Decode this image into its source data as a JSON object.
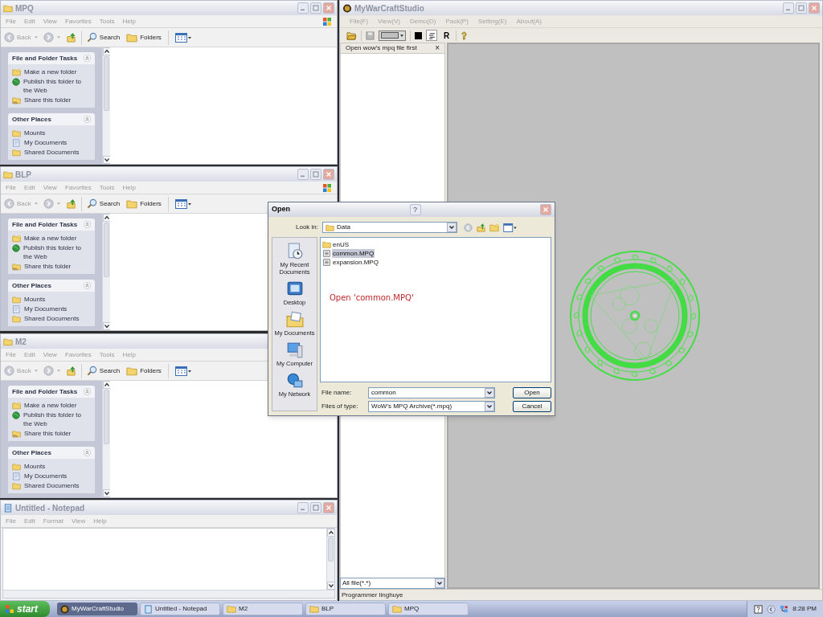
{
  "explorer_windows": [
    {
      "title": "MPQ",
      "menu": [
        "File",
        "Edit",
        "View",
        "Favorites",
        "Tools",
        "Help"
      ],
      "toolbar": {
        "back": "Back",
        "search": "Search",
        "folders": "Folders"
      },
      "task_sections": [
        {
          "title": "File and Folder Tasks",
          "items": [
            {
              "label": "Make a new folder",
              "kind": "new-folder"
            },
            {
              "label": "Publish this folder to the Web",
              "kind": "publish"
            },
            {
              "label": "Share this folder",
              "kind": "share"
            }
          ]
        },
        {
          "title": "Other Places",
          "items": [
            {
              "label": "Mounts",
              "kind": "folder"
            },
            {
              "label": "My Documents",
              "kind": "documents"
            },
            {
              "label": "Shared Documents",
              "kind": "folder"
            }
          ]
        }
      ]
    },
    {
      "title": "BLP",
      "menu": [
        "File",
        "Edit",
        "View",
        "Favorites",
        "Tools",
        "Help"
      ],
      "toolbar": {
        "back": "Back",
        "search": "Search",
        "folders": "Folders"
      },
      "task_sections": [
        {
          "title": "File and Folder Tasks",
          "items": [
            {
              "label": "Make a new folder",
              "kind": "new-folder"
            },
            {
              "label": "Publish this folder to the Web",
              "kind": "publish"
            },
            {
              "label": "Share this folder",
              "kind": "share"
            }
          ]
        },
        {
          "title": "Other Places",
          "items": [
            {
              "label": "Mounts",
              "kind": "folder"
            },
            {
              "label": "My Documents",
              "kind": "documents"
            },
            {
              "label": "Shared Documents",
              "kind": "folder"
            }
          ]
        }
      ]
    },
    {
      "title": "M2",
      "menu": [
        "File",
        "Edit",
        "View",
        "Favorites",
        "Tools",
        "Help"
      ],
      "toolbar": {
        "back": "Back",
        "search": "Search",
        "folders": "Folders"
      },
      "task_sections": [
        {
          "title": "File and Folder Tasks",
          "items": [
            {
              "label": "Make a new folder",
              "kind": "new-folder"
            },
            {
              "label": "Publish this folder to the Web",
              "kind": "publish"
            },
            {
              "label": "Share this folder",
              "kind": "share"
            }
          ]
        },
        {
          "title": "Other Places",
          "items": [
            {
              "label": "Mounts",
              "kind": "folder"
            },
            {
              "label": "My Documents",
              "kind": "documents"
            },
            {
              "label": "Shared Documents",
              "kind": "folder"
            }
          ]
        }
      ]
    }
  ],
  "notepad": {
    "title": "Untitled - Notepad",
    "menu": [
      "File",
      "Edit",
      "Format",
      "View",
      "Help"
    ]
  },
  "studio": {
    "title": "MyWarCraftStudio",
    "menu": [
      "File(F)",
      "View(V)",
      "Demo(D)",
      "Pack(P)",
      "Setting(E)",
      "About(A)"
    ],
    "toolbar_label": "R",
    "panel": {
      "header": "Open wow's mpq file first",
      "close": "×",
      "filter": "All file(*.*)"
    },
    "status_bar": "Programmer linghuye"
  },
  "open_dialog": {
    "title": "Open",
    "help": "?",
    "look_in_label": "Look in:",
    "look_in": "Data",
    "places": [
      {
        "label": "My Recent Documents",
        "kind": "recent"
      },
      {
        "label": "Desktop",
        "kind": "desktop"
      },
      {
        "label": "My Documents",
        "kind": "documents"
      },
      {
        "label": "My Computer",
        "kind": "computer"
      },
      {
        "label": "My Network",
        "kind": "network"
      }
    ],
    "files": [
      {
        "name": "enUS",
        "kind": "folder",
        "selected": false
      },
      {
        "name": "common.MPQ",
        "kind": "archive",
        "selected": true
      },
      {
        "name": "expansion.MPQ",
        "kind": "archive",
        "selected": false
      }
    ],
    "annotation": "Open 'common.MPQ'",
    "file_name_label": "File name:",
    "file_name": "common",
    "file_type_label": "Files of type:",
    "file_type": "WoW's MPQ Archive(*.mpq)",
    "buttons": [
      "Open",
      "Cancel"
    ]
  },
  "taskbar": {
    "start": "start",
    "tasks": [
      {
        "label": "MyWarCraftStudio",
        "kind": "studio",
        "selected": true
      },
      {
        "label": "Untitled - Notepad",
        "kind": "notepad",
        "selected": false
      },
      {
        "label": "M2",
        "kind": "folder",
        "selected": false
      },
      {
        "label": "BLP",
        "kind": "folder",
        "selected": false
      },
      {
        "label": "MPQ",
        "kind": "folder",
        "selected": false
      }
    ],
    "clock": "8:28 PM"
  }
}
